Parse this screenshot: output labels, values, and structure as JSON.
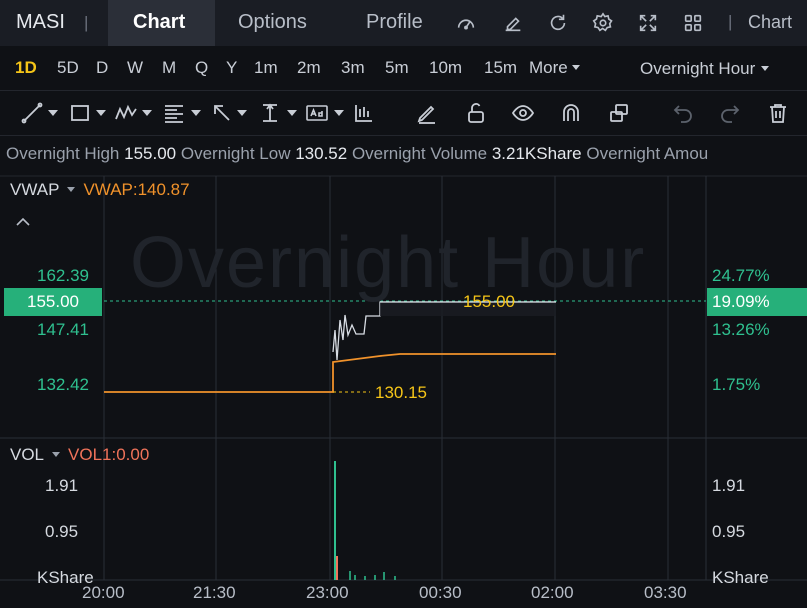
{
  "topbar": {
    "ticker": "MASI",
    "separator": "|",
    "tabs": [
      {
        "label": "Chart",
        "active": true
      },
      {
        "label": "Options",
        "active": false
      },
      {
        "label": "Profile",
        "active": false
      }
    ],
    "icons": [
      "gauge-icon",
      "edit-icon",
      "refresh-icon",
      "gear-icon",
      "expand-icon",
      "grid-icon"
    ],
    "right_label": "Chart"
  },
  "periods": {
    "items": [
      "1D",
      "5D",
      "D",
      "W",
      "M",
      "Q",
      "Y",
      "1m",
      "2m",
      "3m",
      "5m",
      "10m",
      "15m"
    ],
    "active": "1D",
    "more_label": "More",
    "session_label": "Overnight Hour"
  },
  "toolbar": {
    "icons": [
      "trendline-icon",
      "rectangle-icon",
      "pattern-icon",
      "fibonacci-icon",
      "arrow-icon",
      "measure-icon",
      "text-icon",
      "indicator-icon",
      "pencil-icon",
      "unlock-icon",
      "eye-icon",
      "magnet-icon",
      "layers-icon",
      "undo-icon",
      "redo-icon",
      "trash-icon"
    ]
  },
  "info": {
    "high_label": "Overnight High",
    "high_value": "155.00",
    "low_label": "Overnight Low",
    "low_value": "130.52",
    "volume_label": "Overnight Volume",
    "volume_value": "3.21KShare",
    "amount_label": "Overnight Amou"
  },
  "price_panel": {
    "indicator": "VWAP",
    "indicator_value": "VWAP:140.87",
    "watermark": "Overnight Hour",
    "left_axis": [
      "162.39",
      "147.41",
      "132.42"
    ],
    "current_price": "155.00",
    "right_axis": [
      "24.77%",
      "13.26%",
      "1.75%"
    ],
    "current_pct": "19.09%",
    "annot_high": "155.00",
    "annot_low": "130.15"
  },
  "volume_panel": {
    "indicator": "VOL",
    "indicator_value": "VOL1:0.00",
    "left_axis": [
      "1.91",
      "0.95",
      "KShare"
    ],
    "right_axis": [
      "1.91",
      "0.95",
      "KShare"
    ]
  },
  "x_axis": [
    "20:00",
    "21:30",
    "23:00",
    "00:30",
    "02:00",
    "03:30"
  ],
  "colors": {
    "up": "#2fc08f",
    "vwap": "#f0922b",
    "price_line": "#d8dde4",
    "annotation": "#f5c518",
    "background": "#0f1115"
  }
}
